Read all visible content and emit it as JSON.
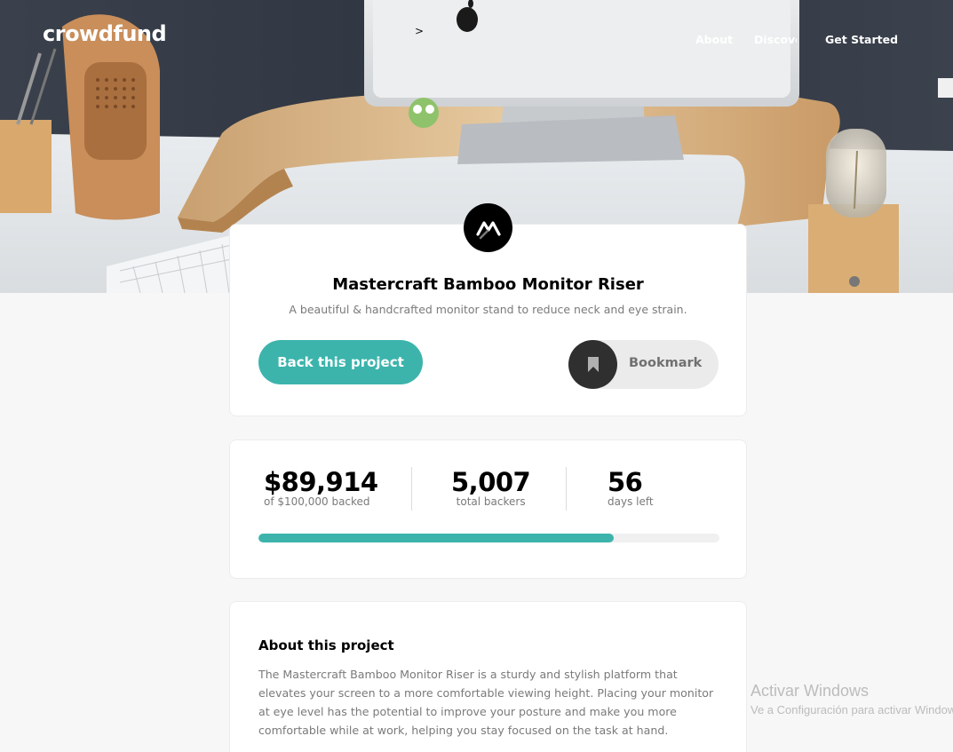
{
  "header": {
    "logo": "crowdfund",
    "nav": [
      {
        "label": "About"
      },
      {
        "label": "Discover"
      },
      {
        "label": "Get Started"
      }
    ],
    "stray_glyph": ">"
  },
  "project": {
    "logo_icon": "mastercraft-logo-icon",
    "title": "Mastercraft Bamboo Monitor Riser",
    "subtitle": "A beautiful & handcrafted monitor stand to reduce neck and eye strain.",
    "back_label": "Back this project",
    "bookmark_label": "Bookmark",
    "bookmark_icon": "bookmark-icon"
  },
  "stats": {
    "backed": {
      "value": "$89,914",
      "label": "of $100,000 backed"
    },
    "backers": {
      "value": "5,007",
      "label": "total backers"
    },
    "days": {
      "value": "56",
      "label": "days left"
    },
    "progress_fraction": 0.77
  },
  "about": {
    "heading": "About this project",
    "text": "The Mastercraft Bamboo Monitor Riser is a sturdy and stylish platform that elevates your screen to a more comfortable viewing height. Placing your monitor at eye level has the potential to improve your posture and make you more comfortable while at work, helping you stay focused on the task at hand."
  },
  "watermark": {
    "line1": "Activar Windows",
    "line2": "Ve a Configuración para activar Windows."
  },
  "colors": {
    "accent": "#3cb4ac",
    "dark": "#2f2f2f",
    "muted_text": "#7a7a7a"
  }
}
